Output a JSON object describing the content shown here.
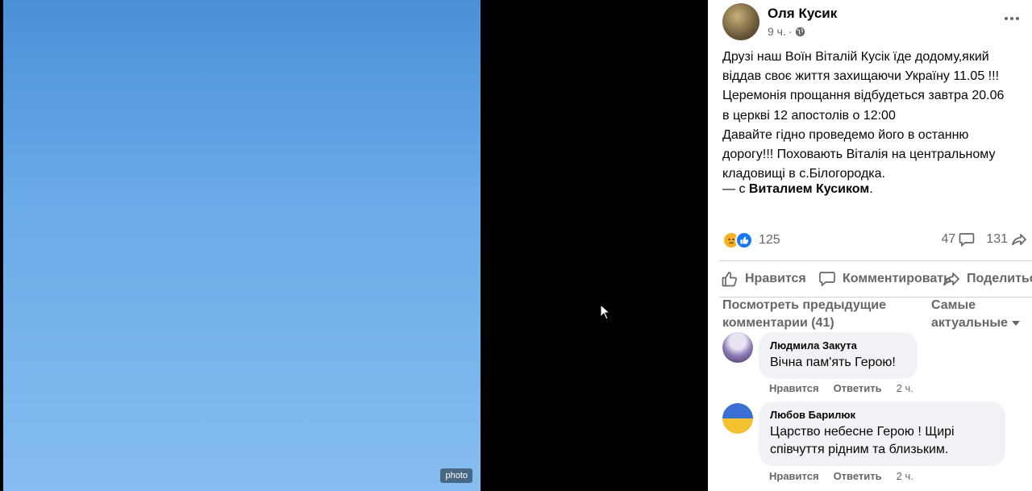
{
  "photo": {
    "placeholder": "photo"
  },
  "post": {
    "author": "Оля Кусик",
    "time": "9 ч.",
    "separator": "·",
    "text_lines": [
      "Друзі наш Воїн Віталій Кусік їде додому,який",
      "віддав своє життя захищаючи Україну 11.05 !!!",
      "Церемонія прощання відбудеться завтра 20.06",
      "в церкві 12 апостолів о 12:00",
      "Давайте гідно проведемо його в останню",
      "дорогу!!! Поховають Віталія на центральному",
      "кладовищі в с.Білогородка."
    ],
    "with_prefix": "— с ",
    "with_name": "Виталием Кусиком",
    "with_suffix": "."
  },
  "stats": {
    "reactions_count": "125",
    "comments_count": "47",
    "shares_count": "131"
  },
  "actions": {
    "like": "Нравится",
    "comment": "Комментировать",
    "share": "Поделиться"
  },
  "comments_section": {
    "prev_comments_line1": "Посмотреть предыдущие",
    "prev_comments_line2": "комментарии (41)",
    "sort_line1": "Самые",
    "sort_line2": "актуальные"
  },
  "comments": [
    {
      "name": "Людмила Закута",
      "text_lines": [
        "Вічна пам'ять Герою!"
      ],
      "like": "Нравится",
      "reply": "Ответить",
      "time": "2 ч."
    },
    {
      "name": "Любов Барилюк",
      "text_lines": [
        "Царство небесне Герою ! Щирі",
        "співчуття рідним та близьким."
      ],
      "like": "Нравится",
      "reply": "Ответить",
      "time": "2 ч."
    }
  ],
  "colors": {
    "secondary_text": "#65676b",
    "bubble_bg": "#f0f2f5",
    "like_blue": "#1877f2",
    "sad_yellow": "#f7b125"
  }
}
